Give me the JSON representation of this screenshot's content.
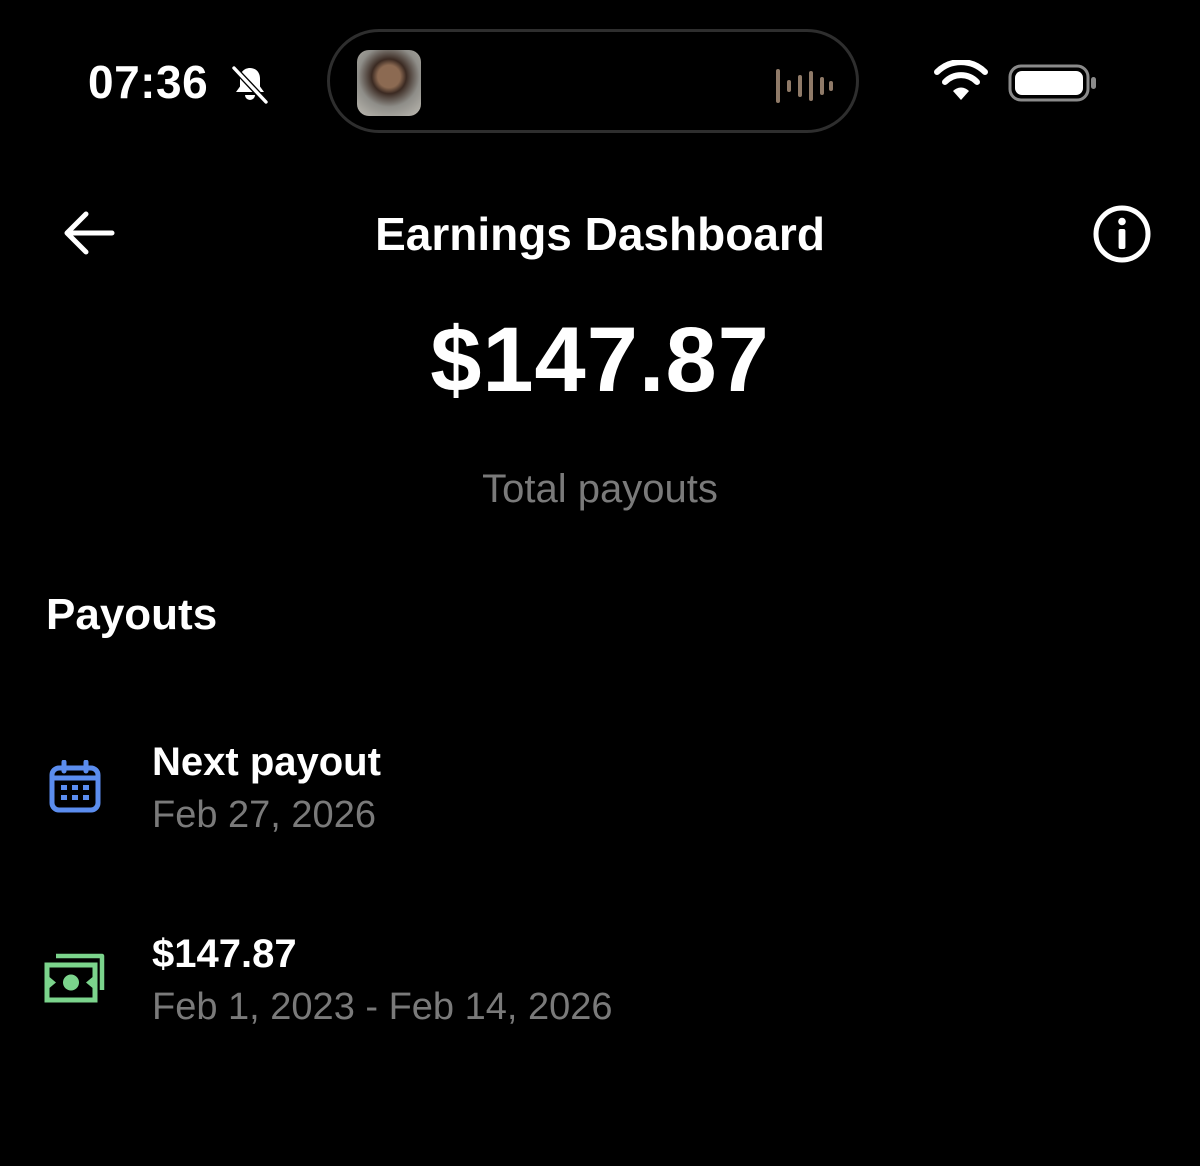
{
  "status_bar": {
    "time": "07:36",
    "icons": [
      "bell-muted-icon",
      "album-thumbnail",
      "audio-wave-icon",
      "wifi-icon",
      "battery-icon"
    ]
  },
  "header": {
    "title": "Earnings Dashboard",
    "back_icon": "back-arrow-icon",
    "info_icon": "info-icon"
  },
  "summary": {
    "amount": "$147.87",
    "label": "Total payouts"
  },
  "payouts": {
    "heading": "Payouts",
    "items": [
      {
        "icon": "calendar-icon",
        "title": "Next payout",
        "subtitle": "Feb 27, 2026"
      },
      {
        "icon": "money-icon",
        "title": "$147.87",
        "subtitle": "Feb 1, 2023 - Feb 14, 2026"
      }
    ]
  },
  "colors": {
    "background": "#000000",
    "text_primary": "#ffffff",
    "text_secondary": "#7a7a7a",
    "calendar_accent": "#5b8def",
    "money_accent": "#7bd48c"
  }
}
